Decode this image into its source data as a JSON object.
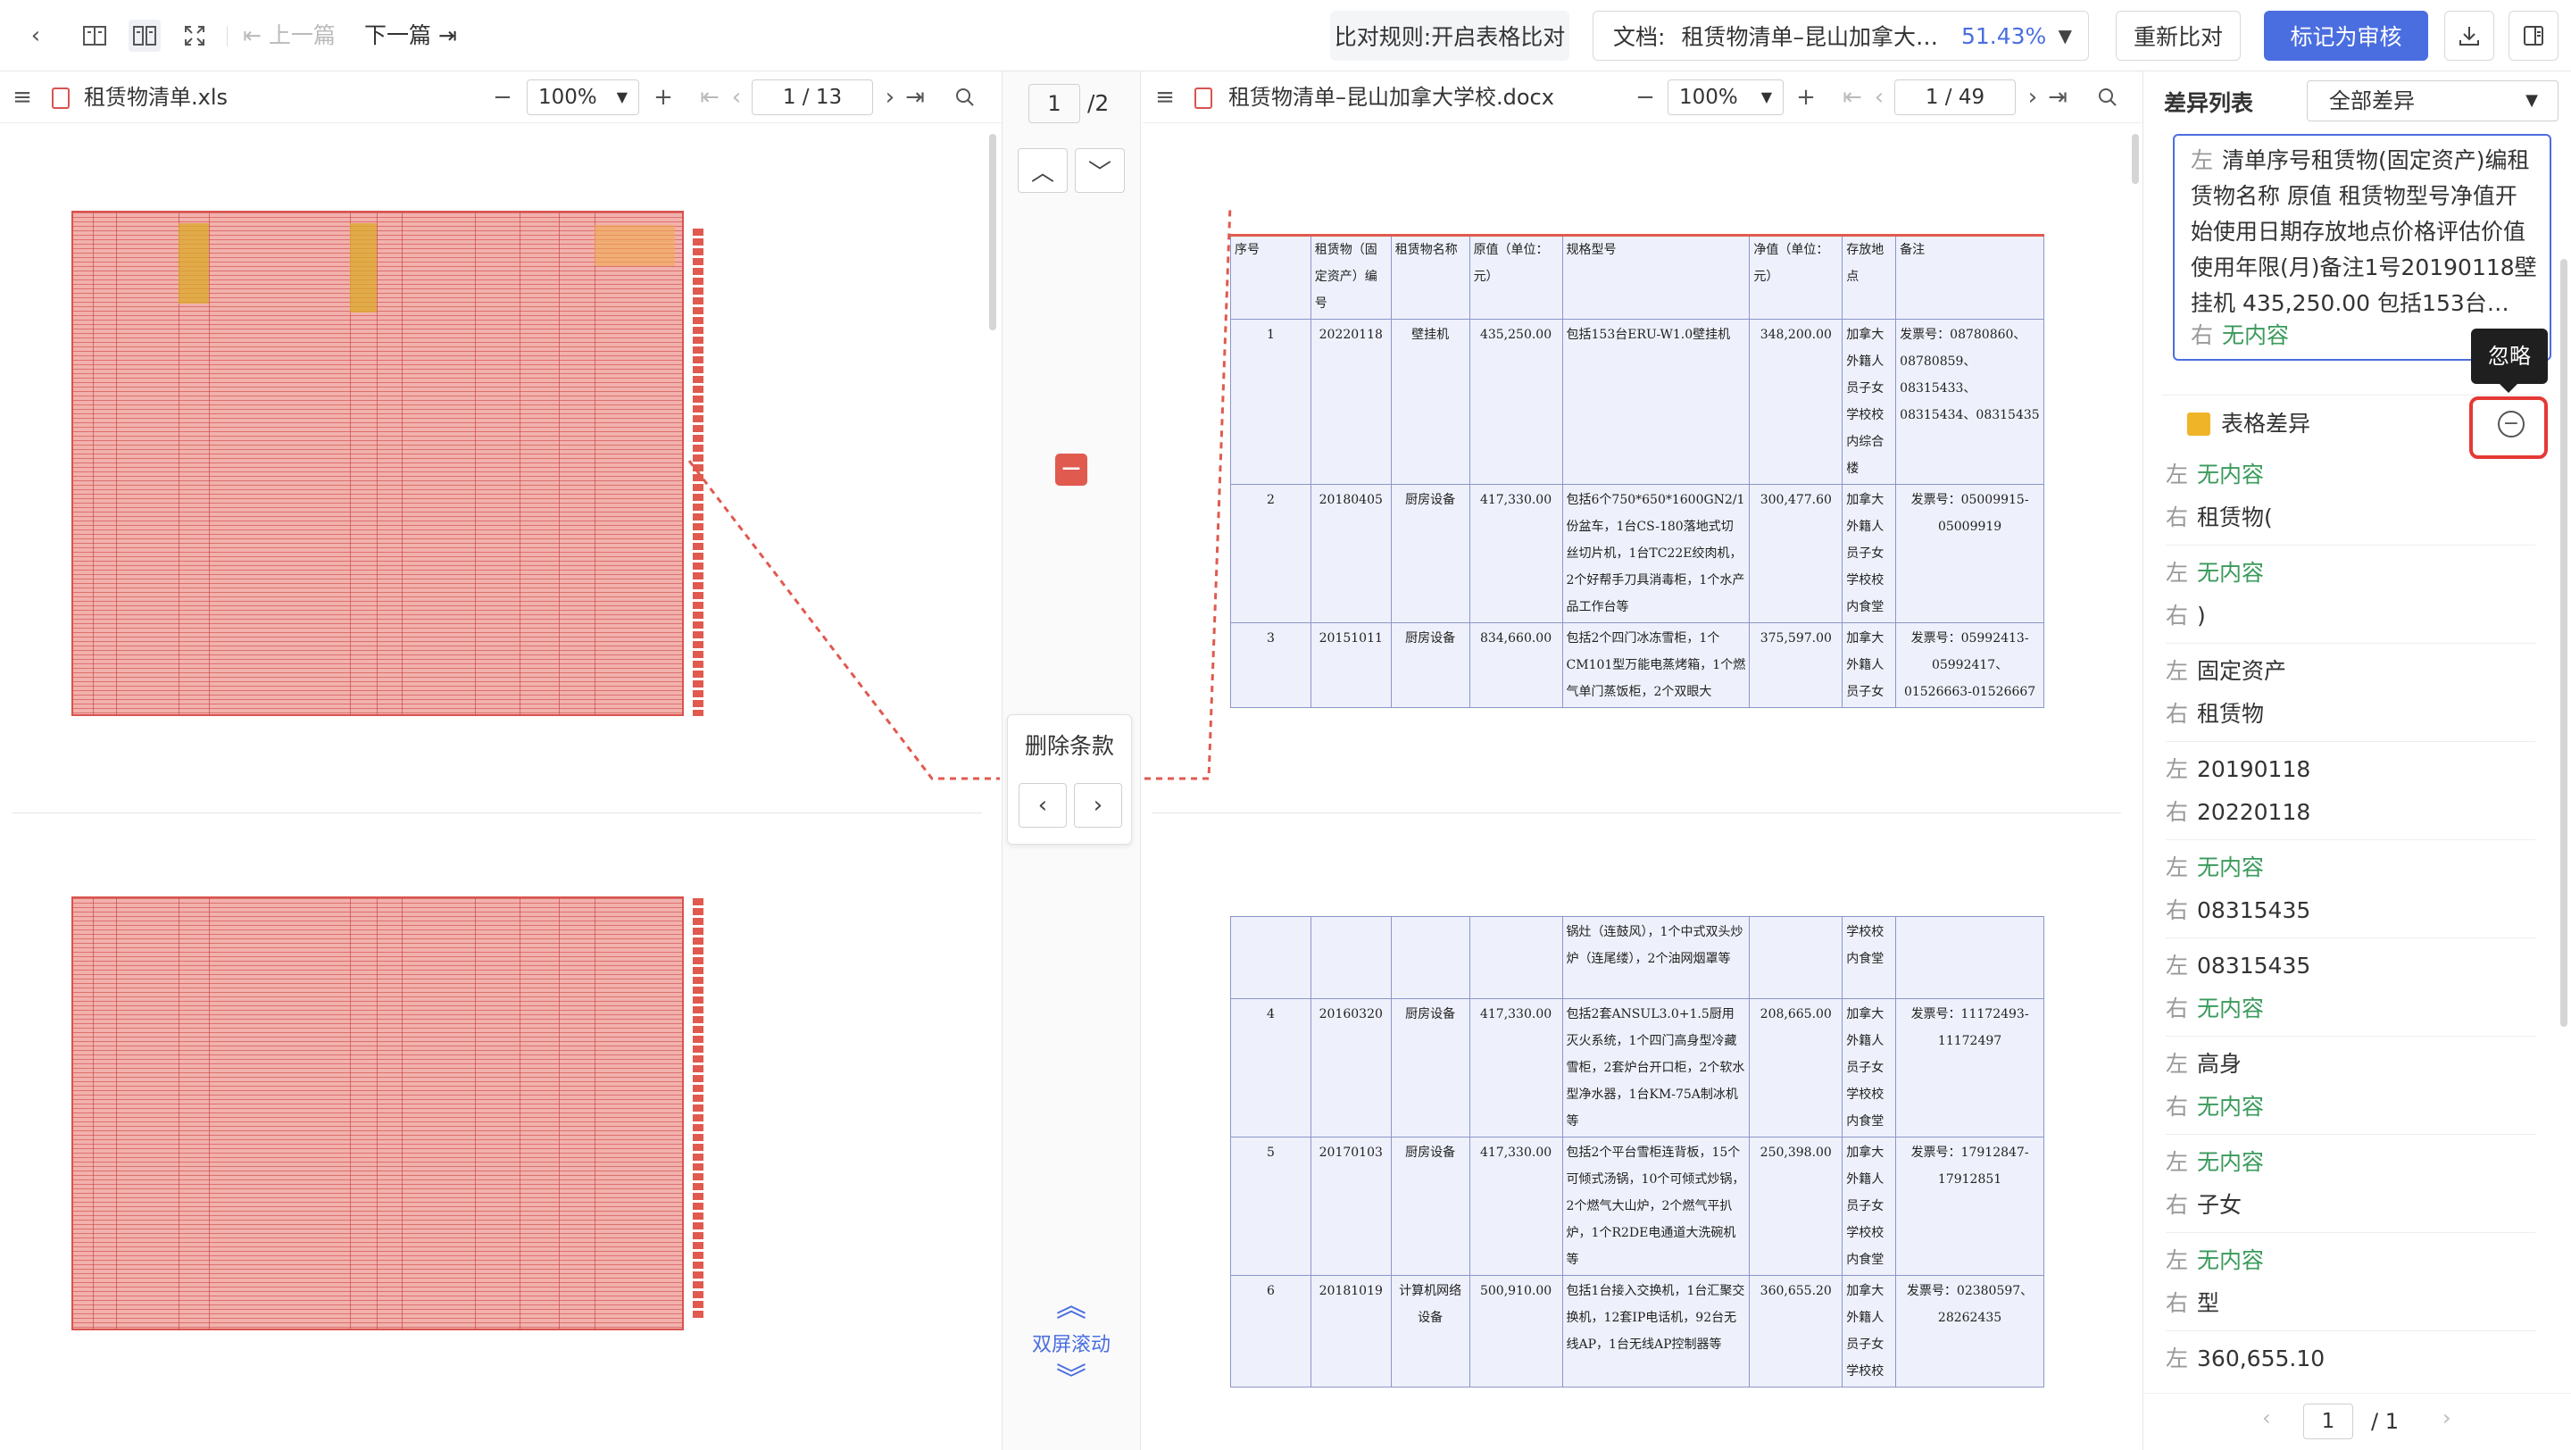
{
  "toolbar": {
    "prev_doc": "上一篇",
    "next_doc": "下一篇",
    "compare_rule": "比对规则:开启表格比对",
    "doc_label": "文档:",
    "doc_name": "租赁物清单–昆山加拿大…",
    "similarity": "51.43%",
    "recompare": "重新比对",
    "mark_reviewed": "标记为审核"
  },
  "left_pane": {
    "file_name": "租赁物清单.xls",
    "zoom": "100%",
    "page": "1 / 13"
  },
  "middle": {
    "page_current": "1",
    "page_total": "/2",
    "diff_type": "删除条款",
    "scroll_mode": "双屏滚动"
  },
  "right_pane": {
    "file_name": "租赁物清单–昆山加拿大学校.docx",
    "zoom": "100%",
    "page": "1 / 49"
  },
  "doc_table1": {
    "headers": [
      "序号",
      "租赁物（固定资产）编号",
      "租赁物名称",
      "原值（单位：元）",
      "规格型号",
      "净值（单位：元）",
      "存放地点",
      "备注"
    ],
    "rows": [
      [
        "1",
        "20220118",
        "壁挂机",
        "435,250.00",
        "包括153台ERU-W1.0壁挂机",
        "348,200.00",
        "加拿大外籍人员子女学校校内综合楼",
        "发票号：08780860、08780859、08315433、08315434、08315435"
      ],
      [
        "2",
        "20180405",
        "厨房设备",
        "417,330.00",
        "包括6个750*650*1600GN2/1份盆车，1台CS-180落地式切丝切片机，1台TC22E绞肉机，2个好帮手刀具消毒柜，1个水产品工作台等",
        "300,477.60",
        "加拿大外籍人员子女学校校内食堂",
        "发票号：05009915-05009919"
      ],
      [
        "3",
        "20151011",
        "厨房设备",
        "834,660.00",
        "包括2个四门冰冻雪柜，1个CM101型万能电蒸烤箱，1个燃气单门蒸饭柜，2个双眼大",
        "375,597.00",
        "加拿大外籍人员子女",
        "发票号：05992413-05992417、01526663-01526667"
      ]
    ]
  },
  "doc_table2": {
    "rows": [
      [
        "",
        "",
        "",
        "",
        "锅灶（连鼓风），1个中式双头炒炉（连尾缕），2个油网烟罩等",
        "",
        "学校校内食堂",
        ""
      ],
      [
        "4",
        "20160320",
        "厨房设备",
        "417,330.00",
        "包括2套ANSUL3.0+1.5厨用灭火系统，1个四门高身型冷藏雪柜，2套炉台开口柜，2个软水型净水器，1台KM-75A制冰机等",
        "208,665.00",
        "加拿大外籍人员子女学校校内食堂",
        "发票号：11172493-11172497"
      ],
      [
        "5",
        "20170103",
        "厨房设备",
        "417,330.00",
        "包括2个平台雪柜连背板，15个可倾式汤锅，10个可倾式炒锅，2个燃气大山炉，2个燃气平扒炉，1个R2DE电通道大洗碗机等",
        "250,398.00",
        "加拿大外籍人员子女学校校内食堂",
        "发票号：17912847-17912851"
      ],
      [
        "6",
        "20181019",
        "计算机网络设备",
        "500,910.00",
        "包括1台接入交换机，1台汇聚交换机，12套IP电话机，92台无线AP，1台无线AP控制器等",
        "360,655.20",
        "加拿大外籍人员子女学校校",
        "发票号：02380597、28262435"
      ]
    ]
  },
  "diff_panel": {
    "title": "差异列表",
    "filter": "全部差异",
    "left_label": "左",
    "right_label": "右",
    "first_item_left": "清单序号租赁物(固定资产)编租赁物名称 原值 租赁物型号净值开始使用日期存放地点价格评估价值使用年限(月)备注1号20190118壁挂机 435,250.00 包括153台…",
    "first_item_right": "无内容",
    "table_diff_title": "表格差异",
    "tooltip": "忽略",
    "items": [
      {
        "left": "无内容",
        "right": "租赁物("
      },
      {
        "left": "无内容",
        "right": ")"
      },
      {
        "left": "固定资产",
        "right": "租赁物"
      },
      {
        "left": "20190118",
        "right": "20220118"
      },
      {
        "left": "无内容",
        "right": "08315435"
      },
      {
        "left": "08315435",
        "right": "无内容"
      },
      {
        "left": "高身",
        "right": "无内容"
      },
      {
        "left": "无内容",
        "right": "子女"
      },
      {
        "left": "无内容",
        "right": "型"
      },
      {
        "left": "360,655.10",
        "right": ""
      }
    ],
    "pager_current": "1",
    "pager_total": "/  1"
  },
  "colors": {
    "primary": "#4a6ee0",
    "delete": "#e05a4f",
    "green": "#3a9a5c"
  }
}
